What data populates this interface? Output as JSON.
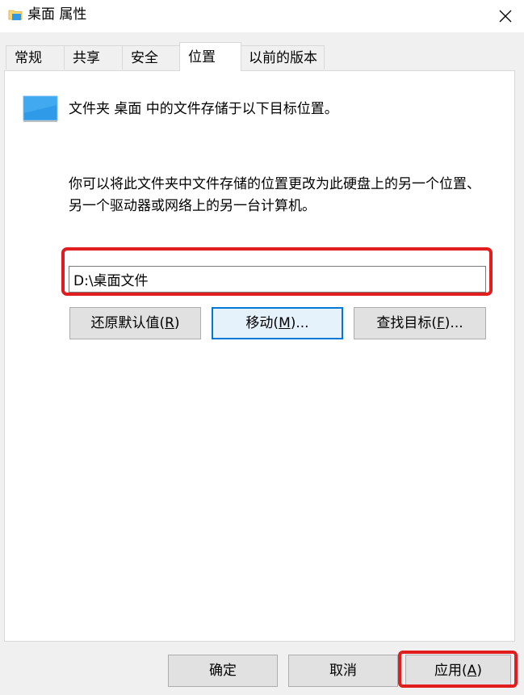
{
  "window": {
    "title": "桌面 属性"
  },
  "tabs": [
    {
      "label": "常规"
    },
    {
      "label": "共享"
    },
    {
      "label": "安全"
    },
    {
      "label": "位置"
    },
    {
      "label": "以前的版本"
    }
  ],
  "location": {
    "heading": "文件夹 桌面 中的文件存储于以下目标位置。",
    "description": "你可以将此文件夹中文件存储的位置更改为此硬盘上的另一个位置、另一个驱动器或网络上的另一台计算机。",
    "path_value": "D:\\桌面文件",
    "restore_label_pre": "还原默认值(",
    "restore_label_key": "R",
    "restore_label_post": ")",
    "move_label_pre": "移动(",
    "move_label_key": "M",
    "move_label_post": ")...",
    "find_label_pre": "查找目标(",
    "find_label_key": "F",
    "find_label_post": ")..."
  },
  "footer": {
    "ok_label": "确定",
    "cancel_label": "取消",
    "apply_label_pre": "应用(",
    "apply_label_key": "A",
    "apply_label_post": ")"
  },
  "colors": {
    "highlight": "#e21d1d",
    "focus": "#0078d7",
    "folder_icon": "#2f9be8"
  }
}
